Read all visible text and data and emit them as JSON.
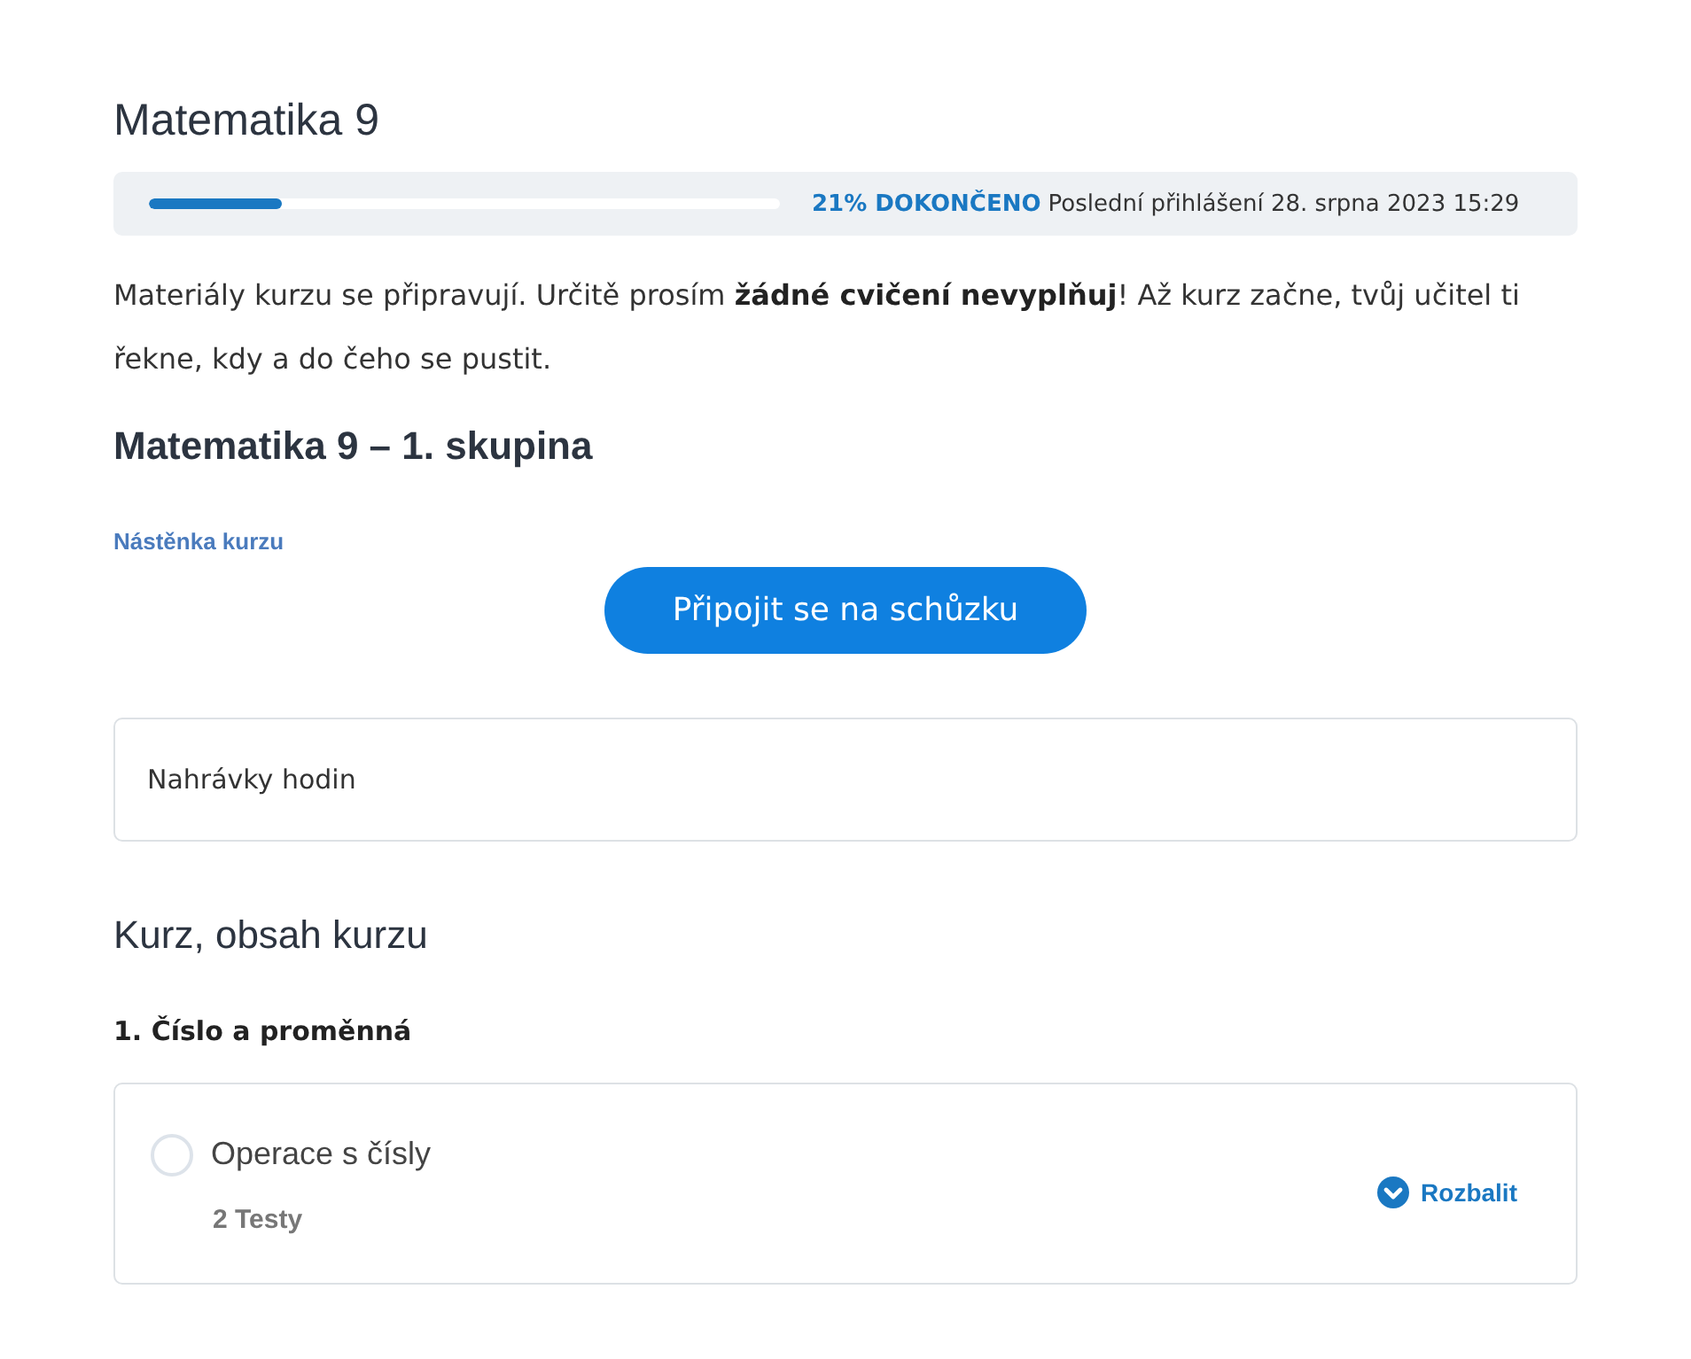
{
  "course": {
    "title": "Matematika 9"
  },
  "progress": {
    "level": 0.21,
    "percent_label": "21% DOKONČENO",
    "last_login": "Poslední přihlášení 28. srpna 2023 15:29"
  },
  "notice": "Materiály kurzu se připravují. Určitě prosím **žádné cvičení nevyplňuj**! Až kurz začne, tvůj učitel ti řekne, kdy a do čeho se pustit.",
  "group": {
    "title": "Matematika 9 – 1. skupina",
    "board_link": "Nástěnka kurzu",
    "meeting_button": "Připojit se na schůzku"
  },
  "recordings": {
    "label": "Nahrávky hodin"
  },
  "content": {
    "title": "Kurz, obsah kurzu",
    "chapters": [
      {
        "title": "1. Číslo a proměnná",
        "lessons": [
          {
            "title": "Operace s čísly",
            "completed": false,
            "meta": "2 Testy",
            "expand_label": "Rozbalit",
            "expanded": false
          }
        ]
      }
    ]
  }
}
